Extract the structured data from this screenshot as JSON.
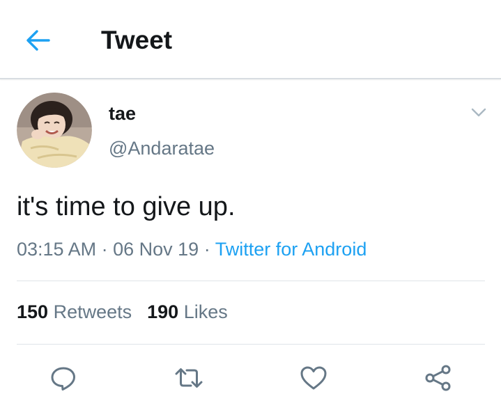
{
  "header": {
    "title": "Tweet",
    "back_icon": "arrow-left-icon",
    "accent_color": "#1da1f2"
  },
  "tweet": {
    "author": {
      "display_name": "tae",
      "handle": "@Andaratae"
    },
    "text": "it's time to give up.",
    "time": "03:15 AM",
    "date": "06 Nov 19",
    "separator": "·",
    "source": "Twitter for Android",
    "retweets": {
      "count": "150",
      "label": "Retweets"
    },
    "likes": {
      "count": "190",
      "label": "Likes"
    }
  },
  "actions": [
    {
      "name": "reply",
      "icon": "reply-bubble-icon"
    },
    {
      "name": "retweet",
      "icon": "retweet-icon"
    },
    {
      "name": "like",
      "icon": "heart-icon"
    },
    {
      "name": "share",
      "icon": "share-icon"
    }
  ],
  "colors": {
    "text_primary": "#14171a",
    "text_secondary": "#657786",
    "link": "#1da1f2",
    "divider": "#dfe4e8"
  }
}
